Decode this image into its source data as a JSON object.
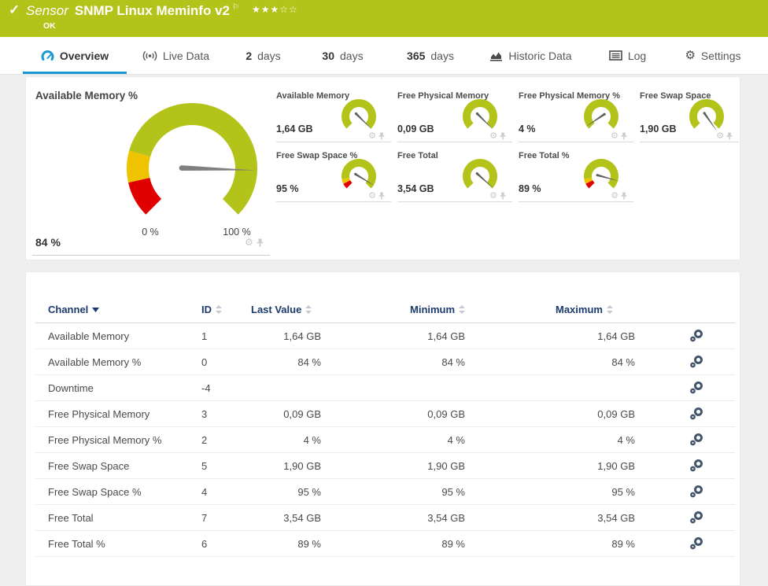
{
  "header": {
    "kind_label": "Sensor",
    "title": "SNMP Linux Meminfo v2",
    "status": "OK",
    "rating_filled": 3,
    "rating_total": 5
  },
  "tabs": [
    {
      "label": "Overview",
      "icon": "gauge-icon",
      "active": true
    },
    {
      "label": "Live Data",
      "icon": "broadcast-icon",
      "active": false
    },
    {
      "num": "2",
      "label": "days",
      "active": false
    },
    {
      "num": "30",
      "label": "days",
      "active": false
    },
    {
      "num": "365",
      "label": "days",
      "active": false
    },
    {
      "label": "Historic Data",
      "icon": "historic-chart-icon",
      "active": false
    },
    {
      "label": "Log",
      "icon": "log-icon",
      "active": false
    },
    {
      "label": "Settings",
      "icon": "gear-icon",
      "active": false
    }
  ],
  "colors": {
    "header_bg": "#b4c319",
    "accent_blue": "#1b9ad2",
    "gauge_green": "#b4c319",
    "gauge_yellow": "#f0c300",
    "gauge_red": "#e10000",
    "needle_gray": "#7f7f7f",
    "table_header_text": "#1d3a6d"
  },
  "gauges": {
    "main": {
      "title": "Available Memory %",
      "value_label": "84 %",
      "value_pct": 84,
      "min_label": "0 %",
      "max_label": "100 %",
      "needle_deg": -1.8,
      "segments": [
        {
          "from": 0,
          "to": 12,
          "color": "#e10000"
        },
        {
          "from": 12,
          "to": 22.5,
          "color": "#f0c300"
        },
        {
          "from": 22.5,
          "to": 100,
          "color": "#b4c319"
        }
      ]
    },
    "small": [
      {
        "title": "Available Memory",
        "value": "1,64 GB",
        "needle_deg": -45,
        "segments": [
          {
            "from": 0,
            "to": 100,
            "color": "#b4c319"
          }
        ]
      },
      {
        "title": "Free Physical Memory",
        "value": "0,09 GB",
        "needle_deg": -45,
        "segments": [
          {
            "from": 0,
            "to": 100,
            "color": "#b4c319"
          }
        ]
      },
      {
        "title": "Free Physical Memory %",
        "value": "4 %",
        "needle_deg": 214,
        "segments": [
          {
            "from": 0,
            "to": 100,
            "color": "#b4c319"
          }
        ]
      },
      {
        "title": "Free Swap Space",
        "value": "1,90 GB",
        "needle_deg": -55,
        "segments": [
          {
            "from": 0,
            "to": 100,
            "color": "#b4c319"
          }
        ]
      },
      {
        "title": "Free Swap Space %",
        "value": "95 %",
        "needle_deg": -31.5,
        "segments": [
          {
            "from": 0,
            "to": 7,
            "color": "#e10000"
          },
          {
            "from": 7,
            "to": 13,
            "color": "#f0c300"
          },
          {
            "from": 13,
            "to": 100,
            "color": "#b4c319"
          }
        ]
      },
      {
        "title": "Free Total",
        "value": "3,54 GB",
        "needle_deg": -42,
        "segments": [
          {
            "from": 0,
            "to": 100,
            "color": "#b4c319"
          }
        ]
      },
      {
        "title": "Free Total %",
        "value": "89 %",
        "needle_deg": -15.3,
        "segments": [
          {
            "from": 0,
            "to": 7,
            "color": "#e10000"
          },
          {
            "from": 7,
            "to": 13,
            "color": "#f0c300"
          },
          {
            "from": 13,
            "to": 100,
            "color": "#b4c319"
          }
        ]
      }
    ]
  },
  "table": {
    "columns": [
      "Channel",
      "ID",
      "Last Value",
      "Minimum",
      "Maximum"
    ],
    "rows": [
      {
        "channel": "Available Memory",
        "id": "1",
        "last": "1,64 GB",
        "min": "1,64 GB",
        "max": "1,64 GB"
      },
      {
        "channel": "Available Memory %",
        "id": "0",
        "last": "84 %",
        "min": "84 %",
        "max": "84 %"
      },
      {
        "channel": "Downtime",
        "id": "-4",
        "last": "",
        "min": "",
        "max": ""
      },
      {
        "channel": "Free Physical Memory",
        "id": "3",
        "last": "0,09 GB",
        "min": "0,09 GB",
        "max": "0,09 GB"
      },
      {
        "channel": "Free Physical Memory %",
        "id": "2",
        "last": "4 %",
        "min": "4 %",
        "max": "4 %"
      },
      {
        "channel": "Free Swap Space",
        "id": "5",
        "last": "1,90 GB",
        "min": "1,90 GB",
        "max": "1,90 GB"
      },
      {
        "channel": "Free Swap Space %",
        "id": "4",
        "last": "95 %",
        "min": "95 %",
        "max": "95 %"
      },
      {
        "channel": "Free Total",
        "id": "7",
        "last": "3,54 GB",
        "min": "3,54 GB",
        "max": "3,54 GB"
      },
      {
        "channel": "Free Total %",
        "id": "6",
        "last": "89 %",
        "min": "89 %",
        "max": "89 %"
      }
    ]
  }
}
